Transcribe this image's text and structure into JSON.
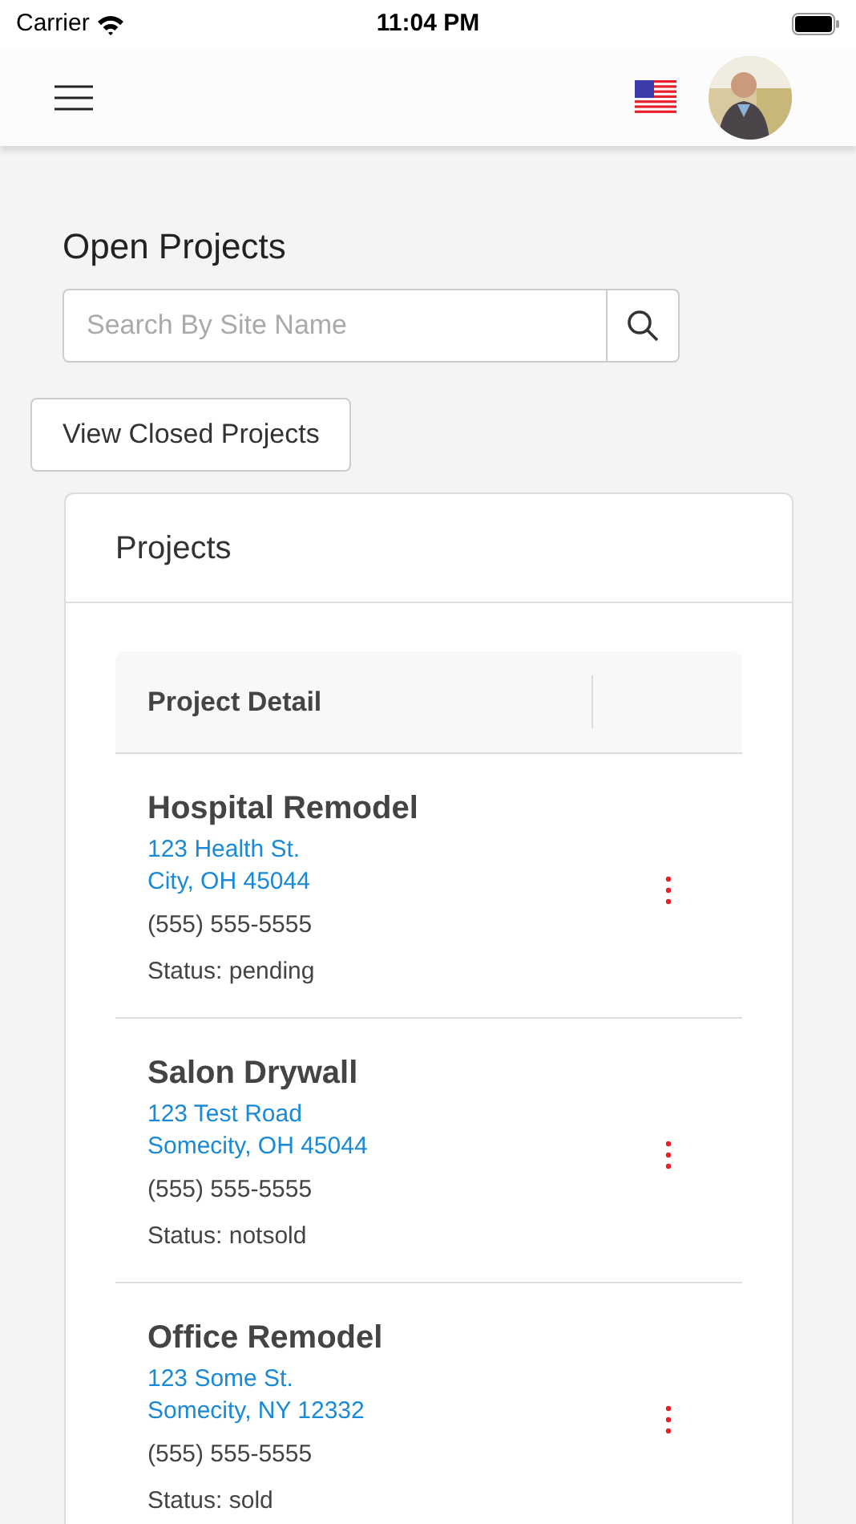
{
  "status_bar": {
    "carrier": "Carrier",
    "time": "11:04 PM"
  },
  "page_title": "Open Projects",
  "search": {
    "placeholder": "Search By Site Name"
  },
  "closed_button": "View Closed Projects",
  "card": {
    "title": "Projects",
    "table": {
      "columns": [
        "Project Detail"
      ],
      "rows": [
        {
          "name": "Hospital Remodel",
          "address_1": "123 Health St.",
          "address_2": "City, OH 45044",
          "phone": "(555) 555-5555",
          "status": "Status: pending"
        },
        {
          "name": "Salon Drywall",
          "address_1": "123 Test Road",
          "address_2": "Somecity, OH 45044",
          "phone": "(555) 555-5555",
          "status": "Status: notsold"
        },
        {
          "name": "Office Remodel",
          "address_1": "123 Some St.",
          "address_2": "Somecity, NY 12332",
          "phone": "(555) 555-5555",
          "status": "Status: sold"
        }
      ]
    }
  }
}
